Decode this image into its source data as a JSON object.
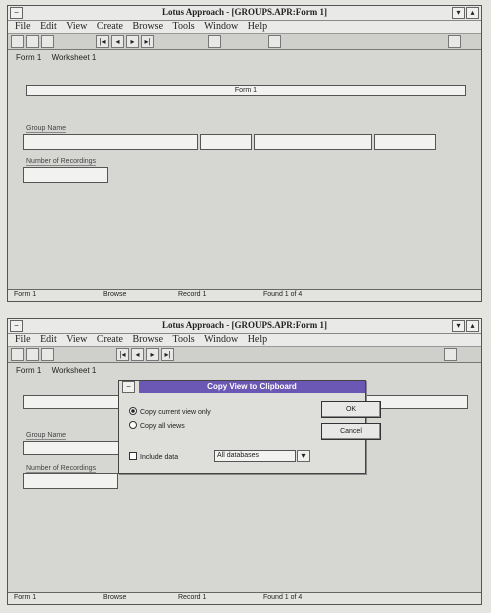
{
  "window_title": "Lotus Approach - [GROUPS.APR:Form 1]",
  "window_title_2": "Lotus Approach - [GROUPS.APR:Form 1]",
  "menu": [
    "File",
    "Edit",
    "View",
    "Create",
    "Browse",
    "Tools",
    "Window",
    "Help"
  ],
  "form": {
    "title_value": "Form 1",
    "label_group": "Group Name",
    "label_num": "Number of Recordings"
  },
  "tabs_top": [
    "Form 1",
    "Worksheet 1"
  ],
  "status_top": [
    "Form 1",
    "Browse",
    "Record 1",
    "Found 1 of 4"
  ],
  "status_bottom": [
    "Form 1",
    "Browse",
    "Record 1",
    "Found 1 of 4"
  ],
  "dialog": {
    "title": "Copy View to Clipboard",
    "option_current": "Copy current view only",
    "option_all": "Copy all views",
    "include_data": "Include data",
    "databases_value": "All databases",
    "ok": "OK",
    "cancel": "Cancel"
  },
  "icons": [
    "control-menu-icon",
    "minimize-icon",
    "maximize-icon",
    "first-record-icon",
    "prev-record-icon",
    "next-record-icon",
    "last-record-icon"
  ]
}
